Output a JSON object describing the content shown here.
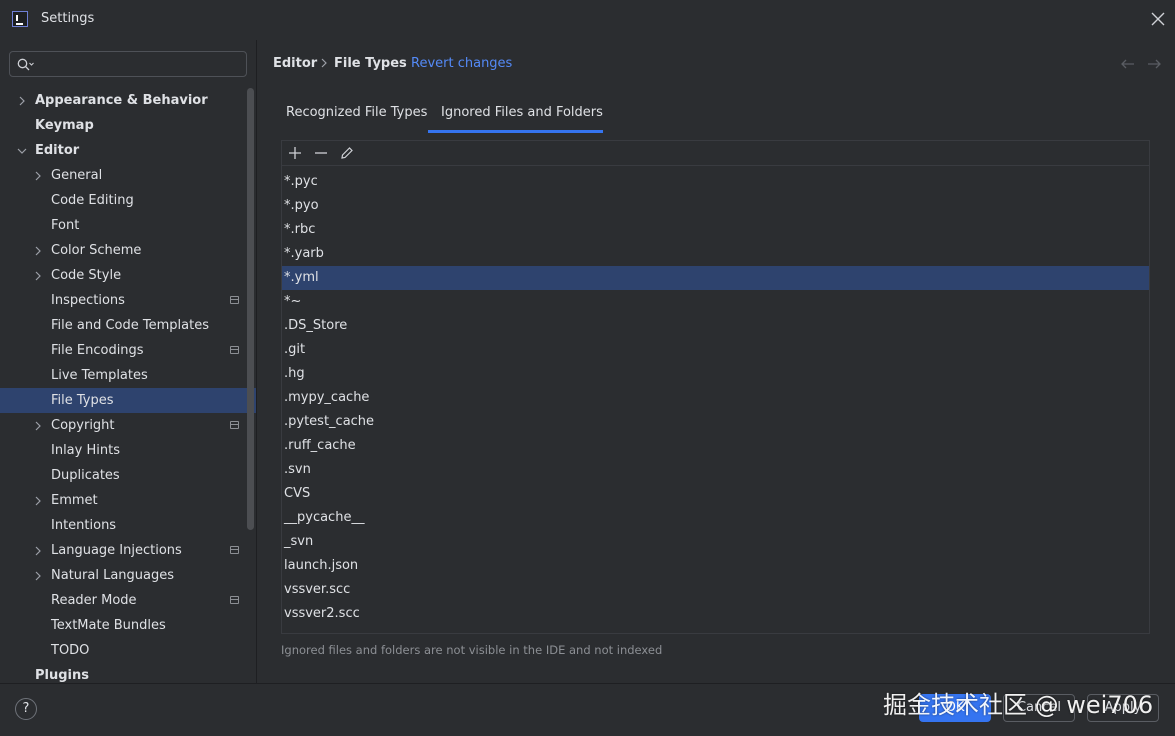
{
  "window": {
    "title": "Settings"
  },
  "search": {
    "placeholder": "",
    "value": ""
  },
  "sidebar": {
    "items": [
      {
        "label": "Appearance & Behavior",
        "bold": true,
        "expandable": true,
        "expanded": false,
        "level": 0
      },
      {
        "label": "Keymap",
        "bold": true,
        "expandable": false,
        "level": 0
      },
      {
        "label": "Editor",
        "bold": true,
        "expandable": true,
        "expanded": true,
        "level": 0
      },
      {
        "label": "General",
        "expandable": true,
        "expanded": false,
        "level": 1
      },
      {
        "label": "Code Editing",
        "expandable": false,
        "level": 1
      },
      {
        "label": "Font",
        "expandable": false,
        "level": 1
      },
      {
        "label": "Color Scheme",
        "expandable": true,
        "expanded": false,
        "level": 1
      },
      {
        "label": "Code Style",
        "expandable": true,
        "expanded": false,
        "level": 1
      },
      {
        "label": "Inspections",
        "expandable": false,
        "level": 1,
        "project_icon": true
      },
      {
        "label": "File and Code Templates",
        "expandable": false,
        "level": 1
      },
      {
        "label": "File Encodings",
        "expandable": false,
        "level": 1,
        "project_icon": true
      },
      {
        "label": "Live Templates",
        "expandable": false,
        "level": 1
      },
      {
        "label": "File Types",
        "expandable": false,
        "level": 1,
        "selected": true
      },
      {
        "label": "Copyright",
        "expandable": true,
        "expanded": false,
        "level": 1,
        "project_icon": true
      },
      {
        "label": "Inlay Hints",
        "expandable": false,
        "level": 1
      },
      {
        "label": "Duplicates",
        "expandable": false,
        "level": 1
      },
      {
        "label": "Emmet",
        "expandable": true,
        "expanded": false,
        "level": 1
      },
      {
        "label": "Intentions",
        "expandable": false,
        "level": 1
      },
      {
        "label": "Language Injections",
        "expandable": true,
        "expanded": false,
        "level": 1,
        "project_icon": true
      },
      {
        "label": "Natural Languages",
        "expandable": true,
        "expanded": false,
        "level": 1
      },
      {
        "label": "Reader Mode",
        "expandable": false,
        "level": 1,
        "project_icon": true
      },
      {
        "label": "TextMate Bundles",
        "expandable": false,
        "level": 1
      },
      {
        "label": "TODO",
        "expandable": false,
        "level": 1
      },
      {
        "label": "Plugins",
        "bold": true,
        "expandable": false,
        "level": 0
      }
    ]
  },
  "breadcrumb": {
    "parent": "Editor",
    "current": "File Types",
    "revert_label": "Revert changes"
  },
  "tabs": [
    {
      "label": "Recognized File Types",
      "active": false
    },
    {
      "label": "Ignored Files and Folders",
      "active": true
    }
  ],
  "toolbar": {
    "add_icon": "plus-icon",
    "remove_icon": "minus-icon",
    "edit_icon": "pencil-icon"
  },
  "ignored_list": {
    "items": [
      "*.pyc",
      "*.pyo",
      "*.rbc",
      "*.yarb",
      "*.yml",
      "*~",
      ".DS_Store",
      ".git",
      ".hg",
      ".mypy_cache",
      ".pytest_cache",
      ".ruff_cache",
      ".svn",
      "CVS",
      "__pycache__",
      "_svn",
      "launch.json",
      "vssver.scc",
      "vssver2.scc"
    ],
    "selected_item": "*.yml"
  },
  "hint": "Ignored files and folders are not visible in the IDE and not indexed",
  "buttons": {
    "help": "?",
    "ok": "OK",
    "cancel": "Cancel",
    "apply": "Apply"
  },
  "watermark": "掘金技术社区 @ wei706",
  "colors": {
    "accent": "#3574f0",
    "selection": "#2e436e",
    "link": "#548af7",
    "background": "#2b2d30"
  }
}
